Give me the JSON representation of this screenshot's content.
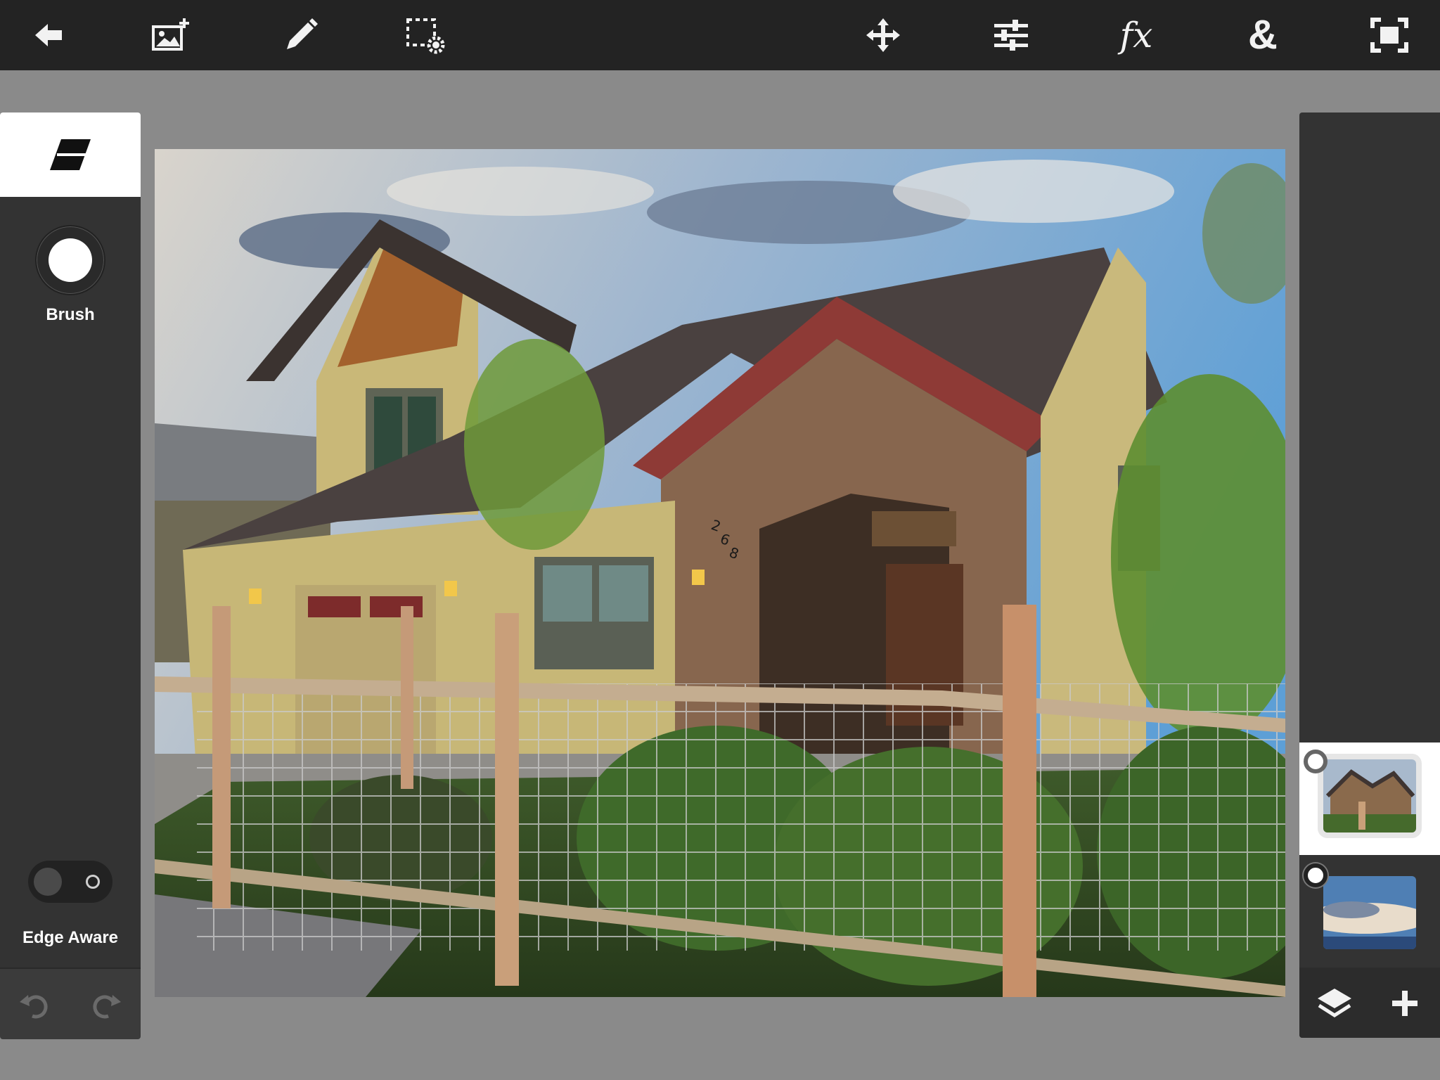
{
  "toolbar": {
    "left": [
      {
        "name": "back-arrow-icon"
      },
      {
        "name": "add-image-icon"
      },
      {
        "name": "pencil-icon"
      },
      {
        "name": "selection-settings-icon"
      }
    ],
    "right": [
      {
        "name": "move-icon"
      },
      {
        "name": "adjustments-sliders-icon"
      },
      {
        "name": "fx-icon",
        "text": "fx"
      },
      {
        "name": "blend-icon",
        "text": "&"
      },
      {
        "name": "fit-screen-icon"
      }
    ]
  },
  "left_panel": {
    "active_tool": "eraser-icon",
    "brush_label": "Brush",
    "edge_aware_label": "Edge Aware",
    "edge_aware_on": false
  },
  "canvas": {
    "house_number": "268"
  },
  "layers": [
    {
      "name": "house-layer",
      "selected": true
    },
    {
      "name": "sky-layer",
      "selected": false
    }
  ],
  "colors": {
    "toolbar_bg": "#232323",
    "panel_bg": "#333333",
    "workspace_bg": "#8a8a8a",
    "selected_bg": "#ffffff"
  }
}
